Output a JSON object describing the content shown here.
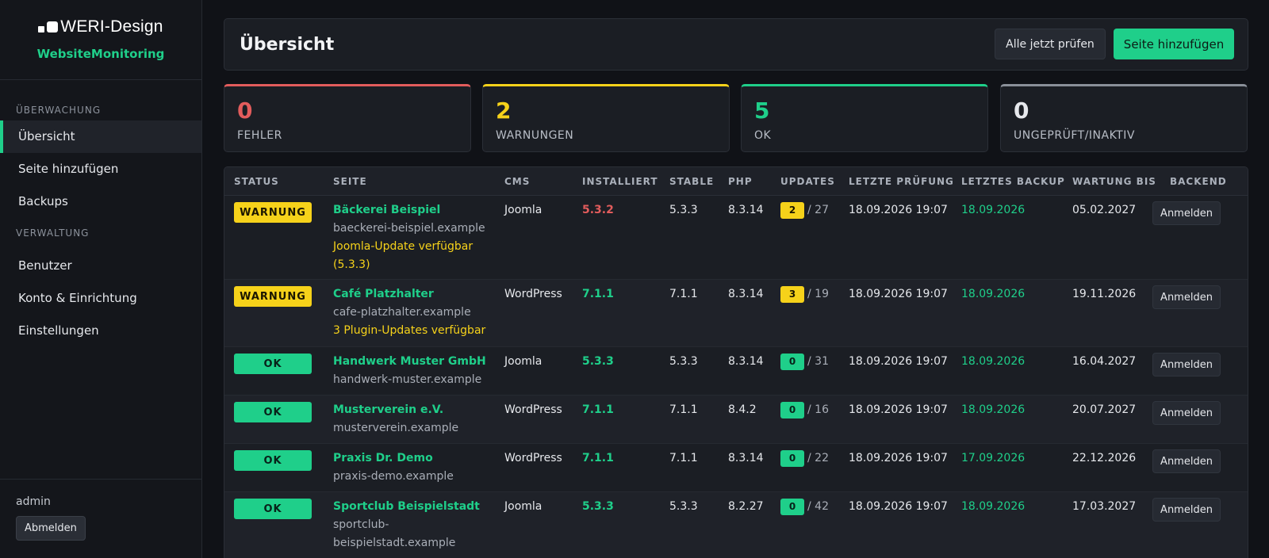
{
  "brand": {
    "logo_text": "WERI-Design",
    "app_name": "WebsiteMonitoring"
  },
  "sidebar": {
    "sections": [
      {
        "title": "ÜBERWACHUNG",
        "items": [
          {
            "label": "Übersicht",
            "active": true
          },
          {
            "label": "Seite hinzufügen"
          },
          {
            "label": "Backups"
          }
        ]
      },
      {
        "title": "VERWALTUNG",
        "items": [
          {
            "label": "Benutzer"
          },
          {
            "label": "Konto & Einrichtung"
          },
          {
            "label": "Einstellungen"
          }
        ]
      }
    ],
    "user": "admin",
    "logout_label": "Abmelden"
  },
  "header": {
    "title": "Übersicht",
    "check_all_label": "Alle jetzt prüfen",
    "add_site_label": "Seite hinzufügen"
  },
  "stats": [
    {
      "value": "0",
      "label": "FEHLER",
      "color": "#e25c5c"
    },
    {
      "value": "2",
      "label": "WARNUNGEN",
      "color": "#f6d21a"
    },
    {
      "value": "5",
      "label": "OK",
      "color": "#1fcf8a"
    },
    {
      "value": "0",
      "label": "UNGEPRÜFT/INAKTIV",
      "color": "#8a9099"
    }
  ],
  "table": {
    "columns": [
      "STATUS",
      "SEITE",
      "CMS",
      "INSTALLIERT",
      "STABLE",
      "PHP",
      "UPDATES",
      "LETZTE PRÜFUNG",
      "LETZTES BACKUP",
      "WARTUNG BIS",
      "BACKEND"
    ],
    "login_label": "Anmelden",
    "rows": [
      {
        "status": "WARNUNG",
        "status_type": "warn",
        "name": "Bäckerei Beispiel",
        "host": "baeckerei-beispiel.example",
        "note": "Joomla-Update verfügbar (5.3.3)",
        "cms": "Joomla",
        "installed": "5.3.2",
        "installed_state": "bad",
        "stable": "5.3.3",
        "php": "8.3.14",
        "updates": "2",
        "updates_total": "/ 27",
        "last_check": "18.09.2026 19:07",
        "last_backup": "18.09.2026",
        "maintenance": "05.02.2027"
      },
      {
        "status": "WARNUNG",
        "status_type": "warn",
        "name": "Café Platzhalter",
        "host": "cafe-platzhalter.example",
        "note": "3 Plugin-Updates verfügbar",
        "cms": "WordPress",
        "installed": "7.1.1",
        "installed_state": "good",
        "stable": "7.1.1",
        "php": "8.3.14",
        "updates": "3",
        "updates_total": "/ 19",
        "last_check": "18.09.2026 19:07",
        "last_backup": "18.09.2026",
        "maintenance": "19.11.2026"
      },
      {
        "status": "OK",
        "status_type": "ok",
        "name": "Handwerk Muster GmbH",
        "host": "handwerk-muster.example",
        "note": "",
        "cms": "Joomla",
        "installed": "5.3.3",
        "installed_state": "good",
        "stable": "5.3.3",
        "php": "8.3.14",
        "updates": "0",
        "updates_total": "/ 31",
        "last_check": "18.09.2026 19:07",
        "last_backup": "18.09.2026",
        "maintenance": "16.04.2027"
      },
      {
        "status": "OK",
        "status_type": "ok",
        "name": "Musterverein e.V.",
        "host": "musterverein.example",
        "note": "",
        "cms": "WordPress",
        "installed": "7.1.1",
        "installed_state": "good",
        "stable": "7.1.1",
        "php": "8.4.2",
        "updates": "0",
        "updates_total": "/ 16",
        "last_check": "18.09.2026 19:07",
        "last_backup": "18.09.2026",
        "maintenance": "20.07.2027"
      },
      {
        "status": "OK",
        "status_type": "ok",
        "name": "Praxis Dr. Demo",
        "host": "praxis-demo.example",
        "note": "",
        "cms": "WordPress",
        "installed": "7.1.1",
        "installed_state": "good",
        "stable": "7.1.1",
        "php": "8.3.14",
        "updates": "0",
        "updates_total": "/ 22",
        "last_check": "18.09.2026 19:07",
        "last_backup": "17.09.2026",
        "maintenance": "22.12.2026"
      },
      {
        "status": "OK",
        "status_type": "ok",
        "name": "Sportclub Beispielstadt",
        "host": "sportclub-beispielstadt.example",
        "note": "",
        "cms": "Joomla",
        "installed": "5.3.3",
        "installed_state": "good",
        "stable": "5.3.3",
        "php": "8.2.27",
        "updates": "0",
        "updates_total": "/ 42",
        "last_check": "18.09.2026 19:07",
        "last_backup": "18.09.2026",
        "maintenance": "17.03.2027"
      }
    ]
  }
}
